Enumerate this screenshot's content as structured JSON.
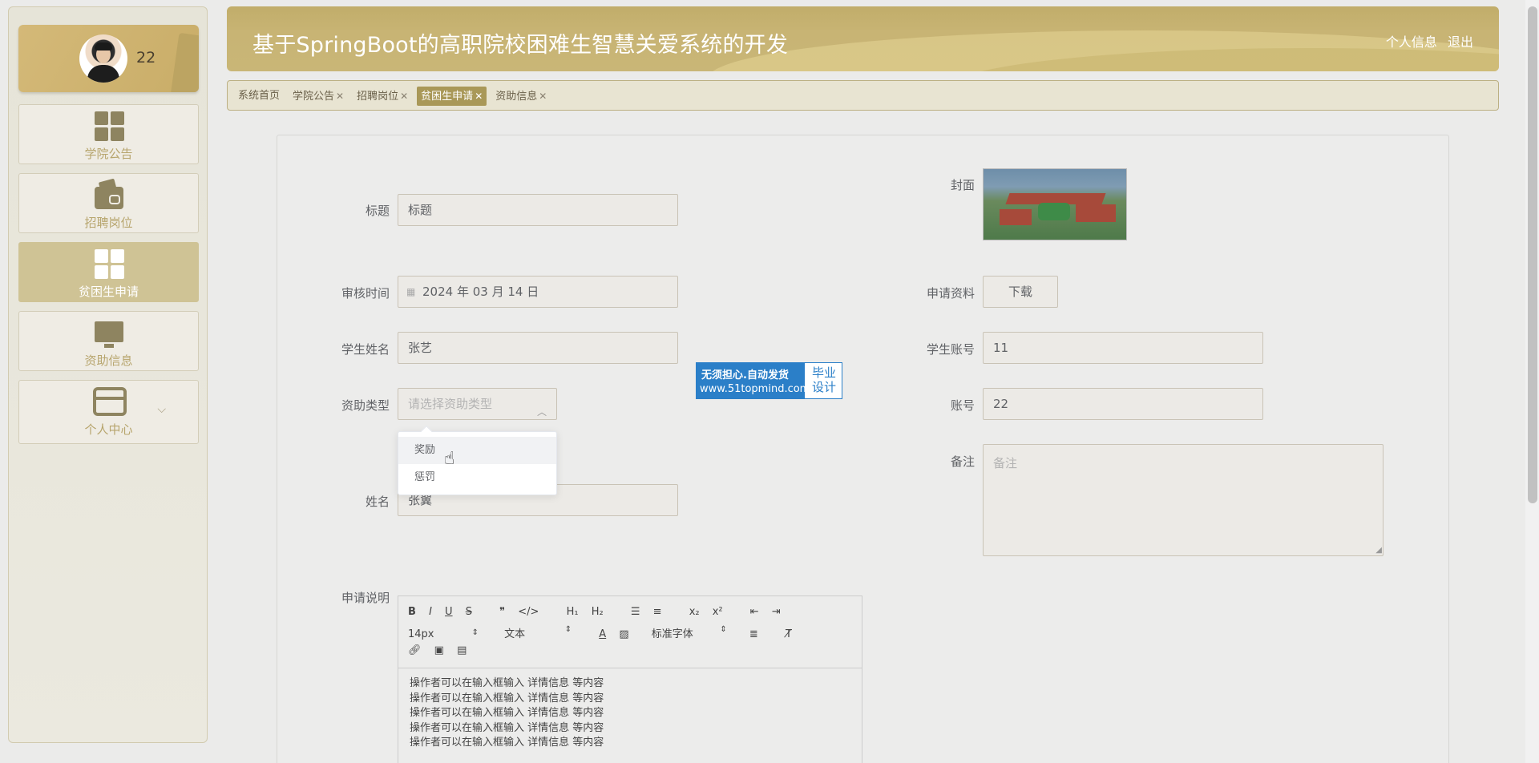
{
  "profile": {
    "name": "22"
  },
  "sidebar": {
    "items": [
      {
        "label": "学院公告",
        "icon": "grid-icon"
      },
      {
        "label": "招聘岗位",
        "icon": "wallet-icon"
      },
      {
        "label": "贫困生申请",
        "icon": "grid-icon",
        "active": true
      },
      {
        "label": "资助信息",
        "icon": "monitor-icon"
      },
      {
        "label": "个人中心",
        "icon": "card-icon"
      }
    ]
  },
  "header": {
    "title": "基于SpringBoot的高职院校困难生智慧关爱系统的开发",
    "links": [
      "个人信息",
      "退出"
    ]
  },
  "tabs": [
    {
      "label": "系统首页",
      "closable": false
    },
    {
      "label": "学院公告",
      "closable": true
    },
    {
      "label": "招聘岗位",
      "closable": true
    },
    {
      "label": "贫困生申请",
      "closable": true,
      "active": true
    },
    {
      "label": "资助信息",
      "closable": true
    }
  ],
  "form": {
    "title_label": "标题",
    "title_value": "标题",
    "cover_label": "封面",
    "audit_time_label": "审核时间",
    "audit_time_value": "2024 年 03 月 14 日",
    "apply_doc_label": "申请资料",
    "download_label": "下载",
    "student_name_label": "学生姓名",
    "student_name_value": "张艺",
    "student_account_label": "学生账号",
    "student_account_value": "11",
    "aid_type_label": "资助类型",
    "aid_type_placeholder": "请选择资助类型",
    "account_label": "账号",
    "account_value": "22",
    "remark_label": "备注",
    "remark_placeholder": "备注",
    "name_label": "姓名",
    "name_value": "张翼",
    "description_label": "申请说明"
  },
  "dropdown": {
    "options": [
      "奖励",
      "惩罚"
    ]
  },
  "watermark": {
    "line1": "无须担心.自动发货",
    "line2": "www.51topmind.com",
    "right": "毕业设计"
  },
  "editor": {
    "font_size": "14px",
    "block_type": "文本",
    "font_family": "标准字体",
    "lines": [
      "操作者可以在输入框输入  详情信息  等内容",
      "操作者可以在输入框输入  详情信息  等内容",
      "操作者可以在输入框输入  详情信息  等内容",
      "操作者可以在输入框输入  详情信息  等内容",
      "操作者可以在输入框输入  详情信息  等内容"
    ]
  },
  "colors": {
    "accent": "#a99858",
    "header": "#c4b06e",
    "active_nav": "#cfc395"
  }
}
